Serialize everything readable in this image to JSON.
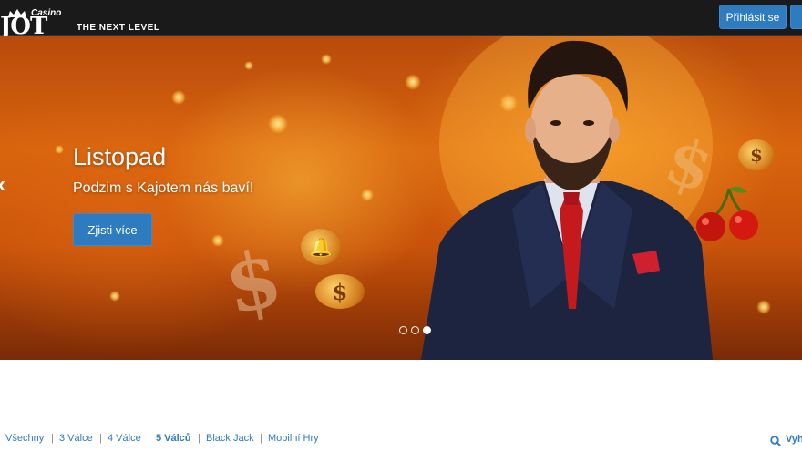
{
  "header": {
    "logo_small": "Casino",
    "logo_main": "JOT",
    "tagline": "THE NEXT LEVEL",
    "login_label": "Přihlásit se"
  },
  "hero": {
    "title": "Listopad",
    "subtitle": "Podzim s Kajotem nás baví!",
    "cta_label": "Zjisti více",
    "prev_icon": "chevron-left-icon",
    "slides_total": 3,
    "active_slide": 3
  },
  "filters": {
    "items": [
      {
        "label": "Všechny",
        "active": false
      },
      {
        "label": "3 Válce",
        "active": false
      },
      {
        "label": "4 Válce",
        "active": false
      },
      {
        "label": "5 Válců",
        "active": true
      },
      {
        "label": "Black Jack",
        "active": false
      },
      {
        "label": "Mobilní Hry",
        "active": false
      }
    ],
    "search_label": "Vyh"
  },
  "colors": {
    "accent": "#2f7bbf",
    "topbar": "#1a1a1a"
  }
}
